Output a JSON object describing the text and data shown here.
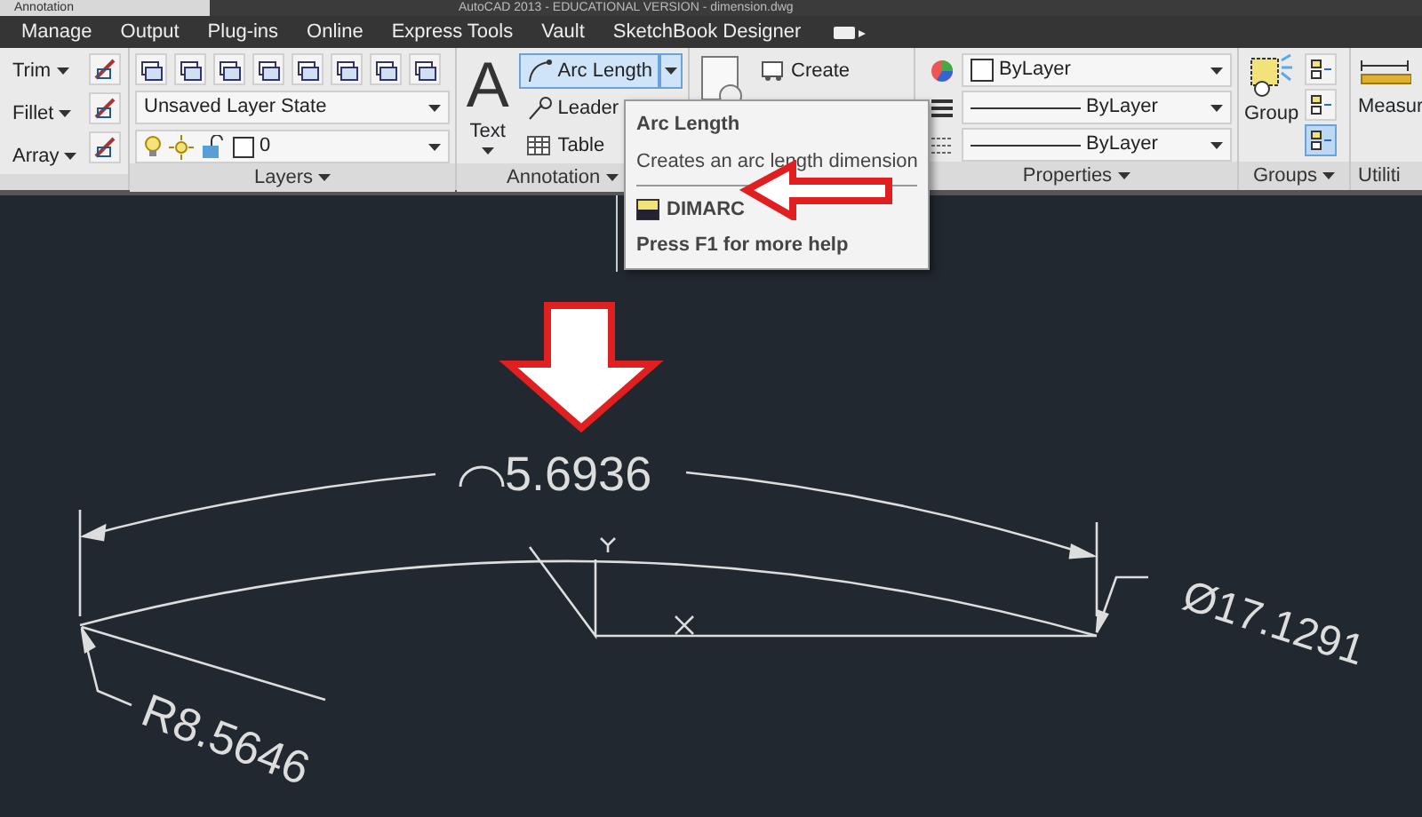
{
  "window": {
    "title": "AutoCAD 2013 - EDUCATIONAL VERSION - dimension.dwg"
  },
  "ribbon_tabs": [
    {
      "label": "Annotation",
      "selected": true
    },
    {
      "label": "Manage",
      "selected": false
    },
    {
      "label": "Output",
      "selected": false
    },
    {
      "label": "Plug-ins",
      "selected": false
    },
    {
      "label": "Online",
      "selected": false
    },
    {
      "label": "Express Tools",
      "selected": false
    },
    {
      "label": "Vault",
      "selected": false
    },
    {
      "label": "SketchBook Designer",
      "selected": false
    }
  ],
  "modify": {
    "tools": [
      {
        "label": "Trim"
      },
      {
        "label": "Fillet"
      },
      {
        "label": "Array"
      }
    ]
  },
  "layers": {
    "label": "Layers",
    "layer_state": "Unsaved Layer State",
    "current_layer": "0"
  },
  "annotation": {
    "label": "Annotation",
    "text_icon": "A",
    "text_button": "Text",
    "tools": [
      {
        "label": "Arc Length",
        "selected": true
      },
      {
        "label": "Leader",
        "selected": false
      },
      {
        "label": "Table",
        "selected": false
      }
    ]
  },
  "block": {
    "create": "Create"
  },
  "properties": {
    "label": "Properties",
    "color_dropdown": "ByLayer",
    "lineweight_dropdown": "ByLayer",
    "linetype_dropdown": "ByLayer"
  },
  "groups": {
    "label": "Groups",
    "group_button": "Group",
    "tools": [
      {
        "selected": false
      },
      {
        "selected": false
      },
      {
        "selected": true
      }
    ]
  },
  "utilities": {
    "label": "Utiliti",
    "measure": "Measur"
  },
  "tooltip": {
    "title": "Arc Length",
    "description": "Creates an arc length dimension",
    "command": "DIMARC",
    "help": "Press F1 for more help"
  },
  "drawing": {
    "arc_length": "5.6936",
    "radius": "R8.5646",
    "diameter": "Ø17.1291"
  }
}
